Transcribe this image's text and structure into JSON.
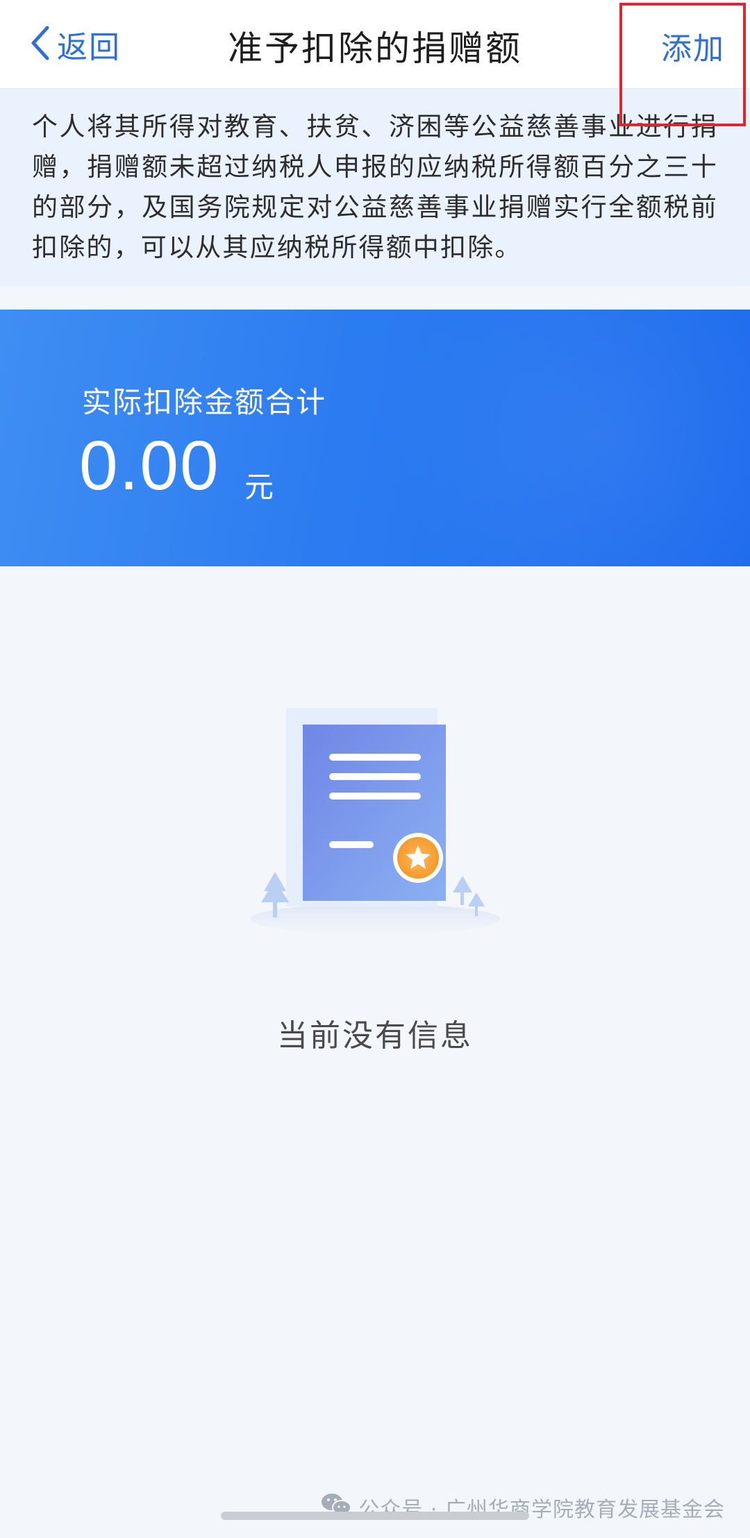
{
  "header": {
    "back_label": "返回",
    "title": "准予扣除的捐赠额",
    "add_label": "添加"
  },
  "notice": {
    "text": "个人将其所得对教育、扶贫、济困等公益慈善事业进行捐赠，捐赠额未超过纳税人申报的应纳税所得额百分之三十的部分，及国务院规定对公益慈善事业捐赠实行全额税前扣除的，可以从其应纳税所得额中扣除。"
  },
  "summary": {
    "label": "实际扣除金额合计",
    "amount": "0.00",
    "unit": "元"
  },
  "empty_state": {
    "icon": "document-star-icon",
    "message": "当前没有信息"
  },
  "watermark": {
    "icon": "wechat-icon",
    "text": "公众号 · 广州华商学院教育发展基金会"
  },
  "colors": {
    "accent": "#2f6fd8",
    "banner_start": "#3f8ef3",
    "banner_end": "#1f6cee",
    "notice_bg": "#eaf3fd",
    "highlight": "#e0262c"
  }
}
